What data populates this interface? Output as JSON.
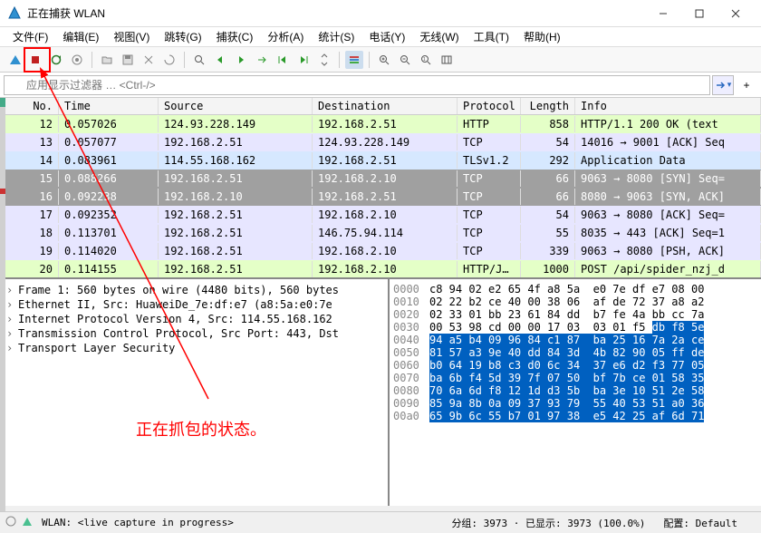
{
  "window": {
    "title": "正在捕获 WLAN"
  },
  "menu": [
    "文件(F)",
    "编辑(E)",
    "视图(V)",
    "跳转(G)",
    "捕获(C)",
    "分析(A)",
    "统计(S)",
    "电话(Y)",
    "无线(W)",
    "工具(T)",
    "帮助(H)"
  ],
  "filter": {
    "placeholder": "应用显示过滤器 … <Ctrl-/>"
  },
  "columns": {
    "no": "No.",
    "time": "Time",
    "source": "Source",
    "destination": "Destination",
    "protocol": "Protocol",
    "length": "Length",
    "info": "Info"
  },
  "packets": [
    {
      "no": "12",
      "time": "0.057026",
      "src": "124.93.228.149",
      "dst": "192.168.2.51",
      "proto": "HTTP",
      "len": "858",
      "info": "HTTP/1.1 200 OK  (text",
      "cls": "http"
    },
    {
      "no": "13",
      "time": "0.057077",
      "src": "192.168.2.51",
      "dst": "124.93.228.149",
      "proto": "TCP",
      "len": "54",
      "info": "14016 → 9001 [ACK] Seq",
      "cls": "tcp"
    },
    {
      "no": "14",
      "time": "0.083961",
      "src": "114.55.168.162",
      "dst": "192.168.2.51",
      "proto": "TLSv1.2",
      "len": "292",
      "info": "Application Data",
      "cls": "tls"
    },
    {
      "no": "15",
      "time": "0.088266",
      "src": "192.168.2.51",
      "dst": "192.168.2.10",
      "proto": "TCP",
      "len": "66",
      "info": "9063 → 8080 [SYN] Seq=",
      "cls": "tcp-syn"
    },
    {
      "no": "16",
      "time": "0.092238",
      "src": "192.168.2.10",
      "dst": "192.168.2.51",
      "proto": "TCP",
      "len": "66",
      "info": "8080 → 9063 [SYN, ACK]",
      "cls": "tcp-syn"
    },
    {
      "no": "17",
      "time": "0.092352",
      "src": "192.168.2.51",
      "dst": "192.168.2.10",
      "proto": "TCP",
      "len": "54",
      "info": "9063 → 8080 [ACK] Seq=",
      "cls": "tcp"
    },
    {
      "no": "18",
      "time": "0.113701",
      "src": "192.168.2.51",
      "dst": "146.75.94.114",
      "proto": "TCP",
      "len": "55",
      "info": "8035 → 443 [ACK] Seq=1",
      "cls": "tcp"
    },
    {
      "no": "19",
      "time": "0.114020",
      "src": "192.168.2.51",
      "dst": "192.168.2.10",
      "proto": "TCP",
      "len": "339",
      "info": "9063 → 8080 [PSH, ACK]",
      "cls": "tcp"
    },
    {
      "no": "20",
      "time": "0.114155",
      "src": "192.168.2.51",
      "dst": "192.168.2.10",
      "proto": "HTTP/J…",
      "len": "1000",
      "info": "POST /api/spider_nzj_d",
      "cls": "http"
    }
  ],
  "details": [
    "Frame 1: 560 bytes on wire (4480 bits), 560 bytes",
    "Ethernet II, Src: HuaweiDe_7e:df:e7 (a8:5a:e0:7e",
    "Internet Protocol Version 4, Src: 114.55.168.162",
    "Transmission Control Protocol, Src Port: 443, Dst",
    "Transport Layer Security"
  ],
  "hex": [
    {
      "off": "0000",
      "bytes": "c8 94 02 e2 65 4f a8 5a  e0 7e df e7 08 00",
      "sel": false
    },
    {
      "off": "0010",
      "bytes": "02 22 b2 ce 40 00 38 06  af de 72 37 a8 a2",
      "sel": false
    },
    {
      "off": "0020",
      "bytes": "02 33 01 bb 23 61 84 dd  b7 fe 4a bb cc 7a",
      "sel": false
    },
    {
      "off": "0030",
      "bytes": "00 53 98 cd 00 00 17 03  03 01 f5 ",
      "sel": false,
      "tail": "db f8 5e",
      "tailsel": true
    },
    {
      "off": "0040",
      "bytes": "94 a5 b4 09 96 84 c1 87  ba 25 16 7a 2a ce",
      "sel": true
    },
    {
      "off": "0050",
      "bytes": "81 57 a3 9e 40 dd 84 3d  4b 82 90 05 ff de",
      "sel": true
    },
    {
      "off": "0060",
      "bytes": "b0 64 19 b8 c3 d0 6c 34  37 e6 d2 f3 77 05",
      "sel": true
    },
    {
      "off": "0070",
      "bytes": "ba 6b f4 5d 39 7f 07 50  bf 7b ce 01 58 35",
      "sel": true
    },
    {
      "off": "0080",
      "bytes": "70 6a 6d f8 12 1d d3 5b  ba 3e 10 51 2e 58",
      "sel": true
    },
    {
      "off": "0090",
      "bytes": "85 9a 8b 0a 09 37 93 79  55 40 53 51 a0 36",
      "sel": true
    },
    {
      "off": "00a0",
      "bytes": "65 9b 6c 55 b7 01 97 38  e5 42 25 af 6d 71",
      "sel": true
    }
  ],
  "status": {
    "capture": "WLAN: <live capture in progress>",
    "packets": "分组: 3973 · 已显示: 3973 (100.0%)",
    "profile": "配置: Default"
  },
  "annotation": {
    "text": "正在抓包的状态。"
  }
}
